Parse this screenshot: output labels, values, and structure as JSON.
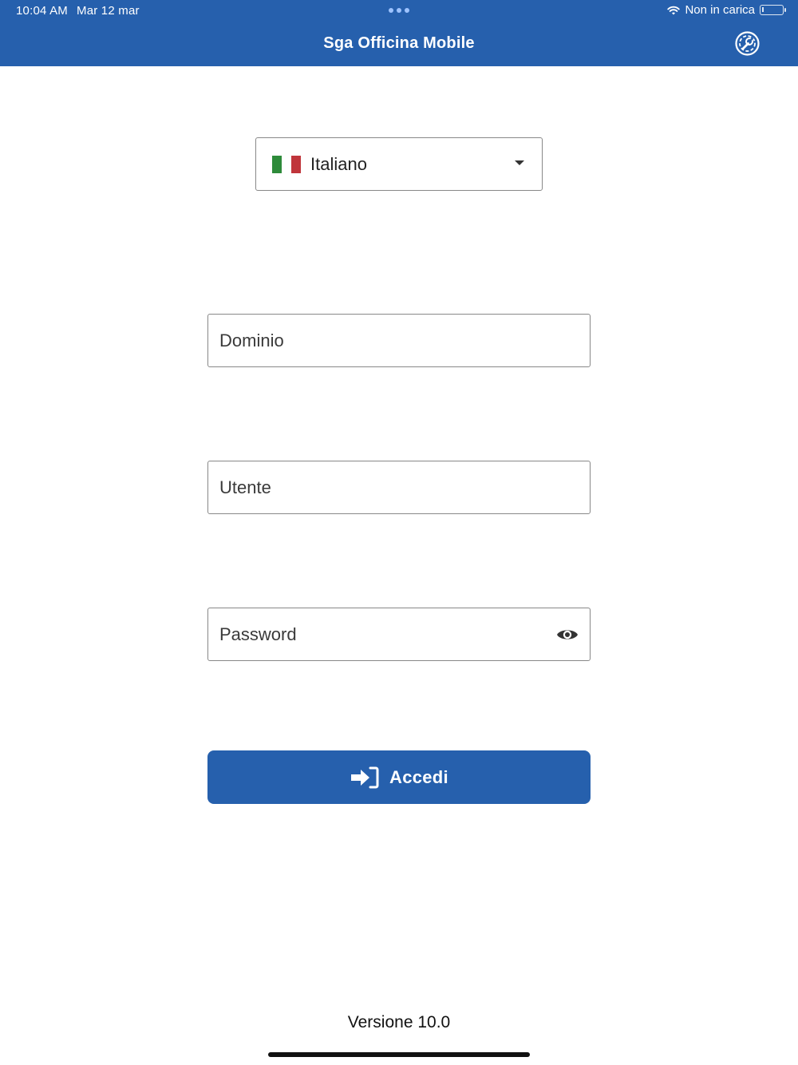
{
  "status_bar": {
    "time": "10:04 AM",
    "date": "Mar 12 mar",
    "charging_status": "Non in carica"
  },
  "header": {
    "title": "Sga Officina Mobile",
    "settings_icon": "settings-wrench-icon"
  },
  "language": {
    "selected": "Italiano",
    "flag": "italy-flag-icon"
  },
  "form": {
    "domain_placeholder": "Dominio",
    "user_placeholder": "Utente",
    "password_placeholder": "Password",
    "password_toggle_icon": "eye-icon"
  },
  "login": {
    "label": "Accedi",
    "icon": "sign-in-icon"
  },
  "footer": {
    "version": "Versione 10.0"
  },
  "colors": {
    "primary": "#2660ad",
    "border": "#888888",
    "text": "#222222"
  }
}
